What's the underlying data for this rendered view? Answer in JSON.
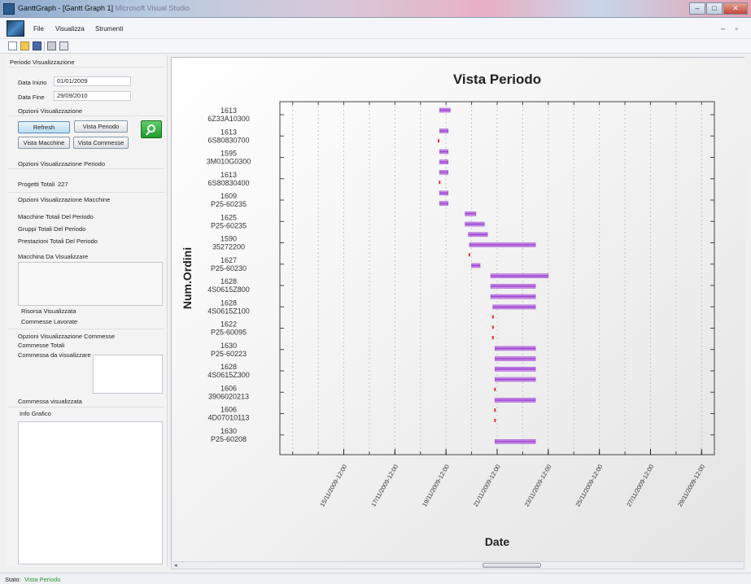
{
  "window": {
    "title": "GanttGraph - [Gantt Graph 1]",
    "title_suffix": "Microsoft Visual Studio"
  },
  "menu": {
    "items": [
      "File",
      "Visualizza",
      "Strumenti"
    ]
  },
  "toolbar": {
    "icons": [
      "new-icon",
      "open-icon",
      "save-icon",
      "print-icon",
      "preview-icon"
    ]
  },
  "left_panel": {
    "periodo_header": "Periodo Visualizzazione",
    "data_inizio_label": "Data Inizio",
    "data_inizio_value": "01/01/2009",
    "data_fine_label": "Data Fine",
    "data_fine_value": "29/09/2010",
    "opzioni_header": "Opzioni Visualizzazione",
    "buttons": {
      "refresh": "Refresh",
      "vista_periodo": "Vista Periodo",
      "vista_macchine": "Vista Macchine",
      "vista_commesse": "Vista Commesse"
    },
    "opzioni_periodo_header": "Opzioni Visualizzazione Periodo",
    "progetti_totali_label": "Progetti Totali",
    "progetti_totali_value": "227",
    "opzioni_macchine_header": "Opzioni Visualizzazione Macchine",
    "macchine_totali_label": "Macchine Totali Del Periodo",
    "gruppi_totali_label": "Gruppi Totali Del Periodo",
    "prestazioni_totali_label": "Prestazioni Totali Del Periodo",
    "macchina_da_visualizzare_label": "Macchina Da Visualizzare",
    "risorsa_visualizzata_label": "Risorsa Visualizzata",
    "commesse_lavorate_label": "Commesse Lavorate",
    "opzioni_commesse_header": "Opzioni Visualizzazione Commesse",
    "commesse_totali_label": "Commesse Totali",
    "commessa_da_visualizzare_label": "Commessa da visualizzare",
    "commessa_visualizzata_label": "Commessa visualizzata",
    "info_grafico_label": "Info Grafico"
  },
  "status": {
    "label": "Stato:",
    "value": "Vista Periodo",
    "value_color": "#2a9a2a"
  },
  "colors": {
    "bar_fill": "#a050d0",
    "bar_edge": "#e0b0f0",
    "point": "#e03030",
    "grid": "#c8c8c8"
  },
  "chart_data": {
    "type": "gantt",
    "title": "Vista Periodo",
    "xlabel": "Date",
    "ylabel": "Num.Ordini",
    "xlim": [
      "2009-11-13 00:00",
      "2009-11-30 00:00"
    ],
    "x_ticks": [
      "15/11/2009-12:00",
      "17/11/2009-12:00",
      "19/11/2009-12:00",
      "21/11/2009-12:00",
      "23/11/2009-12:00",
      "25/11/2009-12:00",
      "27/11/2009-12:00",
      "29/11/2009-12:00"
    ],
    "y_ticks": [
      [
        "1613",
        "6Z33A10300"
      ],
      [
        "1613",
        "6S80830700"
      ],
      [
        "1595",
        "3M010G0300"
      ],
      [
        "1613",
        "6S80830400"
      ],
      [
        "1609",
        "P25-60235"
      ],
      [
        "1625",
        "P25-60235"
      ],
      [
        "1590",
        "35272200"
      ],
      [
        "1627",
        "P25-60230"
      ],
      [
        "1628",
        "4S0615Z800"
      ],
      [
        "1628",
        "4S0615Z100"
      ],
      [
        "1622",
        "P25-60095"
      ],
      [
        "1630",
        "P25-60223"
      ],
      [
        "1628",
        "4S0615Z300"
      ],
      [
        "1606",
        "3906020213"
      ],
      [
        "1606",
        "4D07010113"
      ],
      [
        "1630",
        "P25-60208"
      ]
    ],
    "tasks": [
      {
        "row": 0,
        "start": "2009-11-19 06:00",
        "end": "2009-11-19 16:00"
      },
      {
        "row": 1,
        "start": "2009-11-19 06:00",
        "end": "2009-11-19 14:00"
      },
      {
        "row": 1.5,
        "start": "2009-11-19 05:00",
        "end": "2009-11-19 05:00"
      },
      {
        "row": 2,
        "start": "2009-11-19 06:00",
        "end": "2009-11-19 14:00"
      },
      {
        "row": 2.5,
        "start": "2009-11-19 06:00",
        "end": "2009-11-19 14:00"
      },
      {
        "row": 3,
        "start": "2009-11-19 06:00",
        "end": "2009-11-19 14:00"
      },
      {
        "row": 3.5,
        "start": "2009-11-19 06:00",
        "end": "2009-11-19 06:00"
      },
      {
        "row": 4,
        "start": "2009-11-19 06:00",
        "end": "2009-11-19 14:00"
      },
      {
        "row": 4.5,
        "start": "2009-11-19 06:00",
        "end": "2009-11-19 14:00"
      },
      {
        "row": 5,
        "start": "2009-11-20 06:00",
        "end": "2009-11-20 16:00"
      },
      {
        "row": 5.5,
        "start": "2009-11-20 06:00",
        "end": "2009-11-21 00:00"
      },
      {
        "row": 6,
        "start": "2009-11-20 09:00",
        "end": "2009-11-21 03:00"
      },
      {
        "row": 6.5,
        "start": "2009-11-20 10:00",
        "end": "2009-11-23 00:00"
      },
      {
        "row": 7,
        "start": "2009-11-20 10:00",
        "end": "2009-11-20 10:00"
      },
      {
        "row": 7.5,
        "start": "2009-11-20 12:00",
        "end": "2009-11-20 20:00"
      },
      {
        "row": 8,
        "start": "2009-11-21 06:00",
        "end": "2009-11-23 12:00"
      },
      {
        "row": 8.5,
        "start": "2009-11-21 06:00",
        "end": "2009-11-23 00:00"
      },
      {
        "row": 9,
        "start": "2009-11-21 06:00",
        "end": "2009-11-23 00:00"
      },
      {
        "row": 9.5,
        "start": "2009-11-21 08:00",
        "end": "2009-11-23 00:00"
      },
      {
        "row": 10,
        "start": "2009-11-21 08:00",
        "end": "2009-11-21 08:00"
      },
      {
        "row": 10.5,
        "start": "2009-11-21 08:00",
        "end": "2009-11-21 08:00"
      },
      {
        "row": 11,
        "start": "2009-11-21 08:00",
        "end": "2009-11-21 08:00"
      },
      {
        "row": 11.5,
        "start": "2009-11-21 10:00",
        "end": "2009-11-23 00:00"
      },
      {
        "row": 12,
        "start": "2009-11-21 10:00",
        "end": "2009-11-23 00:00"
      },
      {
        "row": 12.5,
        "start": "2009-11-21 10:00",
        "end": "2009-11-23 00:00"
      },
      {
        "row": 13,
        "start": "2009-11-21 10:00",
        "end": "2009-11-23 00:00"
      },
      {
        "row": 13.5,
        "start": "2009-11-21 10:00",
        "end": "2009-11-21 10:00"
      },
      {
        "row": 14,
        "start": "2009-11-21 10:00",
        "end": "2009-11-23 00:00"
      },
      {
        "row": 14.5,
        "start": "2009-11-21 10:00",
        "end": "2009-11-21 10:00"
      },
      {
        "row": 15,
        "start": "2009-11-21 10:00",
        "end": "2009-11-21 10:00"
      },
      {
        "row": 16,
        "start": "2009-11-21 10:00",
        "end": "2009-11-23 00:00"
      }
    ]
  }
}
